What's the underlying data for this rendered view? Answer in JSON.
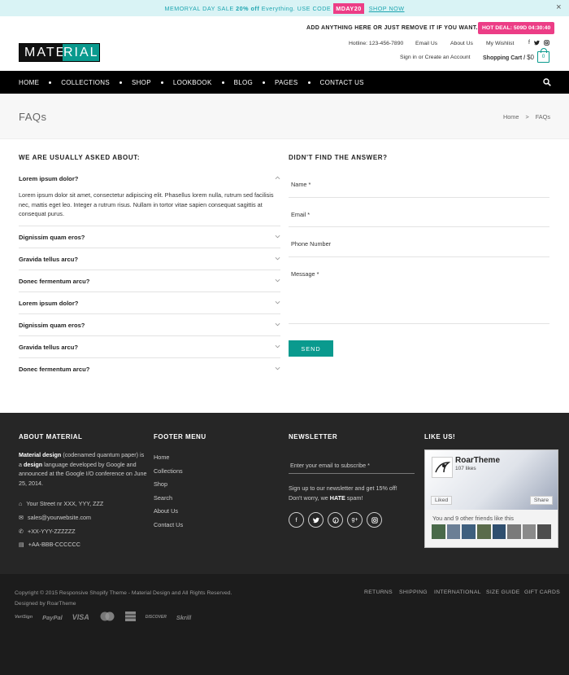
{
  "promo": {
    "pre": "MEMORYAL DAY SALE",
    "pct": "20% off",
    "mid": "Everything. USE CODE",
    "code": "MDAY20",
    "shop": "SHOP NOW",
    "close": "×"
  },
  "header": {
    "logo_a": "MATE",
    "logo_b": "RIAL",
    "message": "ADD ANYTHING HERE OR JUST REMOVE IT IF YOU WANT...",
    "hot_deal": "HOT DEAL: 509D 04:30:40",
    "hotline": "Hotline: 123-456-7890",
    "email": "Email Us",
    "about": "About Us",
    "wishlist": "My Wishlist",
    "signin": "Sign in",
    "or": "or",
    "create": "Create an Account",
    "cart_label": "Shopping Cart",
    "cart_sep": "/",
    "cart_amount": "$0",
    "cart_count": "0"
  },
  "nav": {
    "items": [
      "HOME",
      "COLLECTIONS",
      "SHOP",
      "LOOKBOOK",
      "BLOG",
      "PAGES",
      "CONTACT US"
    ]
  },
  "page": {
    "title": "FAQs",
    "crumb_home": "Home",
    "crumb_sep": ">",
    "crumb_current": "FAQs"
  },
  "faq": {
    "heading": "WE ARE USUALLY ASKED ABOUT:",
    "items": [
      {
        "q": "Lorem ipsum dolor?",
        "a": "Lorem ipsum dolor sit amet, consectetur adipiscing elit. Phasellus lorem nulla, rutrum sed facilisis nec, mattis eget leo. Integer a rutrum risus. Nullam in tortor vitae sapien consequat sagittis at consequat purus."
      },
      {
        "q": "Dignissim quam eros?"
      },
      {
        "q": "Gravida tellus arcu?"
      },
      {
        "q": "Donec fermentum arcu?"
      },
      {
        "q": "Lorem ipsum dolor?"
      },
      {
        "q": "Dignissim quam eros?"
      },
      {
        "q": "Gravida tellus arcu?"
      },
      {
        "q": "Donec fermentum arcu?"
      }
    ]
  },
  "contact": {
    "heading": "DIDN'T FIND THE ANSWER?",
    "name": "Name *",
    "email": "Email *",
    "phone": "Phone Number",
    "message": "Message *",
    "send": "SEND"
  },
  "footer": {
    "about_h": "ABOUT MATERIAL",
    "about_b1": "Material design",
    "about_t1": " (codenamed quantum paper) is a ",
    "about_b2": "design",
    "about_t2": " language developed by Google and announced at the Google I/O conference on June 25, 2014.",
    "street": "Your Street nr XXX, YYY, ZZZ",
    "mail": "sales@yourwebsite.com",
    "phone": "+XX-YYY-ZZZZZZ",
    "fax": "+AA-BBB-CCCCCC",
    "menu_h": "FOOTER MENU",
    "menu": [
      "Home",
      "Collections",
      "Shop",
      "Search",
      "About Us",
      "Contact Us"
    ],
    "news_h": "NEWSLETTER",
    "news_placeholder": "Enter your email to subscribe *",
    "news_t1": "Sign up to our newsletter and get 15% off! Don't worry, we ",
    "news_b": "HATE",
    "news_t2": " spam!",
    "like_h": "LIKE US!",
    "fb_name": "RoarTheme",
    "fb_likes": "107 likes",
    "fb_liked": "Liked",
    "fb_share": "Share",
    "fb_friends": "You and 9 other friends like this",
    "copyright": "Copyright © 2015 Responsive Shopify Theme - Material Design and All Rights Reserved.",
    "designed": "Designed by RoarTheme",
    "links": [
      "RETURNS",
      "SHIPPING",
      "INTERNATIONAL",
      "SIZE GUIDE",
      "GIFT CARDS"
    ],
    "payments": [
      "VeriSign",
      "PayPal",
      "VISA",
      "MasterCard",
      "AMEX",
      "DISCOVER",
      "Skrill"
    ]
  }
}
